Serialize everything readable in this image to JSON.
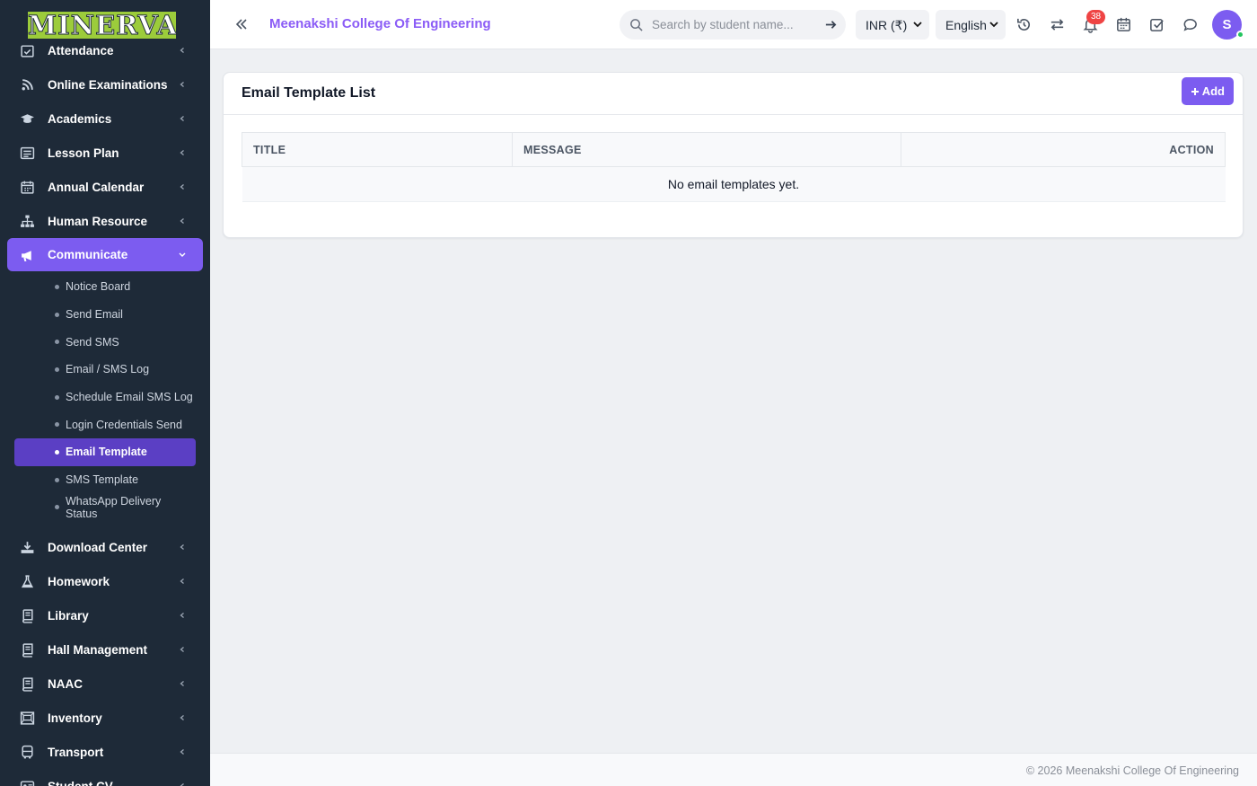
{
  "brand": {
    "logo_text": "MINERVA"
  },
  "header": {
    "college_name": "Meenakshi College Of Engineering",
    "search_placeholder": "Search by student name...",
    "currency": "INR (₹)",
    "language": "English",
    "notification_count": "38",
    "avatar_initial": "S"
  },
  "sidebar": {
    "items_top": [
      {
        "label": "Attendance",
        "icon": "calendar-check-icon"
      },
      {
        "label": "Online Examinations",
        "icon": "rss-icon"
      },
      {
        "label": "Academics",
        "icon": "graduation-cap-icon"
      },
      {
        "label": "Lesson Plan",
        "icon": "list-icon"
      },
      {
        "label": "Annual Calendar",
        "icon": "calendar-icon"
      },
      {
        "label": "Human Resource",
        "icon": "sitemap-icon"
      }
    ],
    "active_group": {
      "label": "Communicate",
      "icon": "bullhorn-icon"
    },
    "sub_items": [
      {
        "label": "Notice Board"
      },
      {
        "label": "Send Email"
      },
      {
        "label": "Send SMS"
      },
      {
        "label": "Email / SMS Log"
      },
      {
        "label": "Schedule Email SMS Log"
      },
      {
        "label": "Login Credentials Send"
      },
      {
        "label": "Email Template",
        "active": true
      },
      {
        "label": "SMS Template"
      },
      {
        "label": "WhatsApp Delivery Status"
      }
    ],
    "items_bottom": [
      {
        "label": "Download Center",
        "icon": "download-icon"
      },
      {
        "label": "Homework",
        "icon": "flask-icon"
      },
      {
        "label": "Library",
        "icon": "book-icon"
      },
      {
        "label": "Hall Management",
        "icon": "book-icon"
      },
      {
        "label": "NAAC",
        "icon": "book-icon"
      },
      {
        "label": "Inventory",
        "icon": "inventory-icon"
      },
      {
        "label": "Transport",
        "icon": "bus-icon"
      },
      {
        "label": "Student CV",
        "icon": "id-card-icon"
      }
    ]
  },
  "main": {
    "card_title": "Email Template List",
    "add_button": "Add",
    "table": {
      "headers": [
        "TITLE",
        "MESSAGE",
        "ACTION"
      ],
      "empty_message": "No email templates yet."
    }
  },
  "footer": {
    "text": "© 2026 Meenakshi College Of Engineering"
  },
  "colors": {
    "accent": "#7c5cf0",
    "college_name": "#8b5cf6",
    "sidebar_bg": "#1e2a38",
    "active_sub": "#5b3fc4",
    "logo_bg": "#9ccc3b",
    "badge": "#ef4444"
  }
}
